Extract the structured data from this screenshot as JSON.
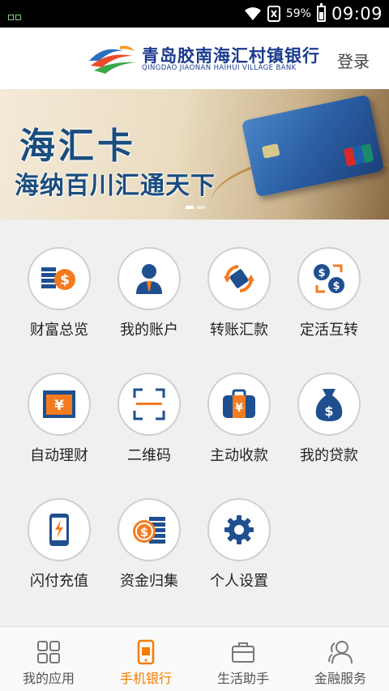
{
  "status_bar": {
    "battery": "59%",
    "time": "09:09"
  },
  "header": {
    "bank_name": "青岛胶南海汇村镇银行",
    "bank_name_en": "QINGDAO JIAONAN HAIHUI VILLAGE BANK",
    "login": "登录"
  },
  "banner": {
    "title": "海汇卡",
    "subtitle": "海纳百川汇通天下",
    "slides": 2,
    "active_slide": 1
  },
  "menu": [
    {
      "label": "财富总览",
      "icon": "coins-dollar-icon"
    },
    {
      "label": "我的账户",
      "icon": "user-account-icon"
    },
    {
      "label": "转账汇款",
      "icon": "transfer-card-icon"
    },
    {
      "label": "定活互转",
      "icon": "exchange-dollar-icon"
    },
    {
      "label": "自动理财",
      "icon": "yen-screen-icon"
    },
    {
      "label": "二维码",
      "icon": "qr-scan-icon"
    },
    {
      "label": "主动收款",
      "icon": "yen-wallet-icon"
    },
    {
      "label": "我的贷款",
      "icon": "money-bag-icon"
    },
    {
      "label": "闪付充值",
      "icon": "phone-flash-icon"
    },
    {
      "label": "资金归集",
      "icon": "coin-stack-icon"
    },
    {
      "label": "个人设置",
      "icon": "gear-icon"
    }
  ],
  "tabs": [
    {
      "label": "我的应用",
      "icon": "grid-apps-icon",
      "active": false
    },
    {
      "label": "手机银行",
      "icon": "mobile-bank-icon",
      "active": true
    },
    {
      "label": "生活助手",
      "icon": "briefcase-icon",
      "active": false
    },
    {
      "label": "金融服务",
      "icon": "people-service-icon",
      "active": false
    }
  ],
  "colors": {
    "icon_blue": "#1f4f8f",
    "icon_orange": "#f47b20",
    "accent": "#f57c00",
    "brand_blue": "#1b3b8f"
  }
}
